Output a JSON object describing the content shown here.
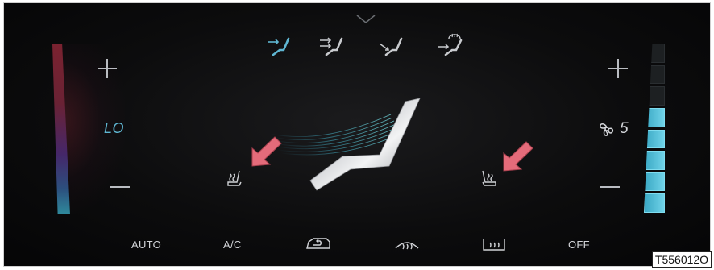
{
  "climate": {
    "left": {
      "temperature": "LO"
    },
    "right": {
      "fan_speed": "5",
      "fan_level": 5,
      "fan_max": 8
    },
    "airflow_modes": [
      "windscreen-airflow-icon",
      "face-airflow-icon",
      "foot-airflow-icon",
      "defrost-airflow-icon"
    ],
    "active_mode_index": 0
  },
  "bottom_bar": {
    "auto_label": "AUTO",
    "ac_label": "A/C",
    "off_label": "OFF"
  },
  "image_code": "T556012O",
  "colors": {
    "accent_blue": "#5fb6d2",
    "fan_active": "#5cc7e0",
    "arrow_pink": "#e46b7a",
    "text": "#d2d4d8"
  }
}
